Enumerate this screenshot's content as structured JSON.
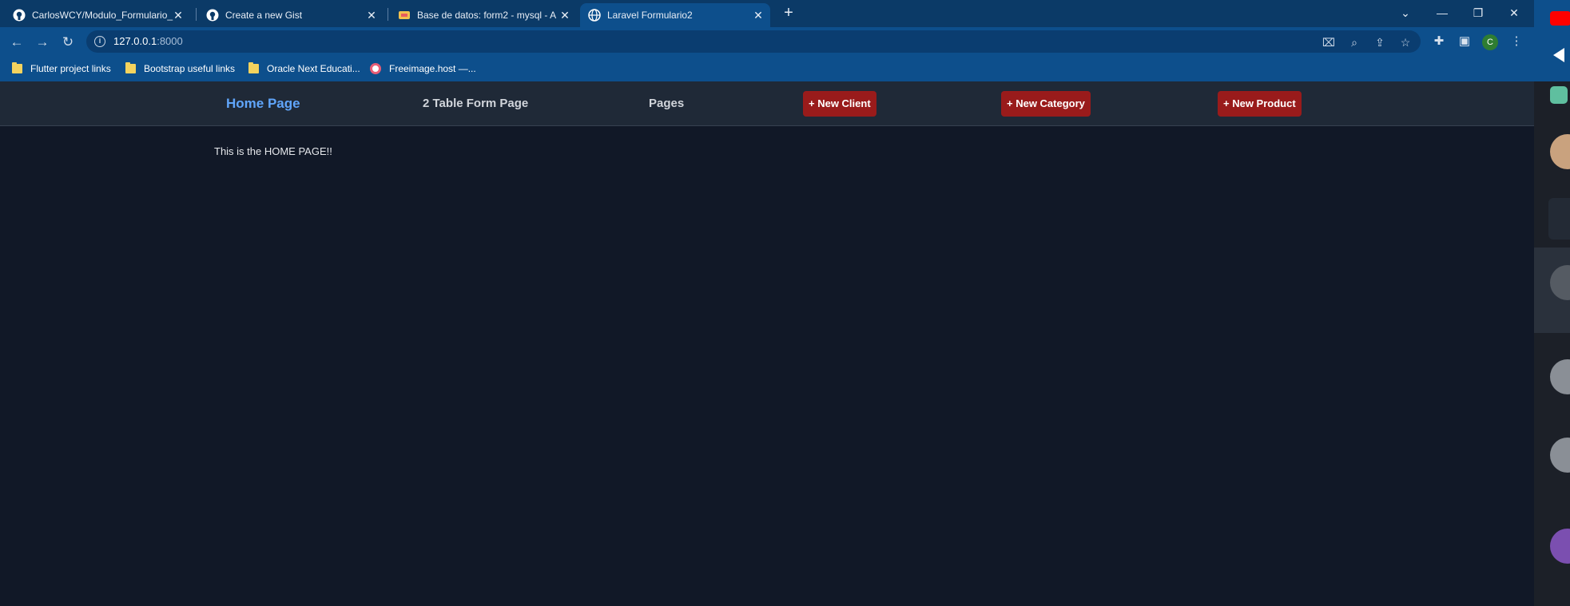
{
  "browser": {
    "tabs": [
      {
        "title": "CarlosWCY/Modulo_Formulario_",
        "icon": "github-icon"
      },
      {
        "title": "Create a new Gist",
        "icon": "github-icon"
      },
      {
        "title": "Base de datos: form2 - mysql - A",
        "icon": "phpmyadmin-icon"
      },
      {
        "title": "Laravel Formulario2",
        "icon": "globe-icon",
        "active": true
      }
    ],
    "url_host": "127.0.0.1",
    "url_port": ":8000",
    "profile_initial": "C",
    "bookmarks": [
      {
        "label": "Flutter project links",
        "icon": "folder-icon"
      },
      {
        "label": "Bootstrap useful links",
        "icon": "folder-icon"
      },
      {
        "label": "Oracle Next Educati...",
        "icon": "folder-icon"
      },
      {
        "label": "Freeimage.host —...",
        "icon": "freeimage-icon"
      }
    ]
  },
  "nav": {
    "home": "Home Page",
    "table_form": "2 Table Form Page",
    "pages": "Pages",
    "new_client": "+ New Client",
    "new_category": "+ New Category",
    "new_product": "+ New Product"
  },
  "content": {
    "text": "This is the HOME PAGE!!"
  },
  "colors": {
    "page_bg": "#111827",
    "navbar_bg": "#1f2937",
    "home_link": "#60a5fa",
    "button_red": "#991b1b",
    "chrome_blue": "#0d4f8c"
  }
}
